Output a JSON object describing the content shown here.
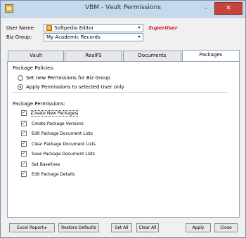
{
  "window": {
    "title": "VBM - Vault Permissions",
    "minimize_glyph": "–",
    "close_glyph": "✕"
  },
  "form": {
    "user_name_label": "User Name:",
    "user_name_value": "Softpedia Editor",
    "role_badge": "SuperUser",
    "biz_group_label": "Biz Group:",
    "biz_group_value": "My Academic Records",
    "dropdown_glyph": "▾",
    "logo_badge_glyph": "s"
  },
  "tabs": [
    {
      "label": "Vault",
      "active": false
    },
    {
      "label": "RealFS",
      "active": false
    },
    {
      "label": "Documents",
      "active": false
    },
    {
      "label": "Packages",
      "active": true
    }
  ],
  "packages": {
    "policies_label": "Package Policies:",
    "option_biz_group": "Set new Permissions for Biz Group",
    "option_selected_user": "Apply Permissions to selected User only",
    "selected_option": "option_selected_user",
    "permissions_label": "Package Permissions:",
    "permissions": [
      {
        "label": "Create New Packages",
        "checked": true
      },
      {
        "label": "Create Package Versions",
        "checked": true
      },
      {
        "label": "Edit Package Document Lists",
        "checked": true
      },
      {
        "label": "Clear Package Document Lists",
        "checked": true
      },
      {
        "label": "Save Package Document Lists",
        "checked": true
      },
      {
        "label": "Set Baselines",
        "checked": true
      },
      {
        "label": "Edit Package Details",
        "checked": true
      }
    ],
    "check_glyph": "✓"
  },
  "buttons": {
    "excel_report": "Excel Report",
    "excel_arrow": "▸",
    "restore_defaults": "Restore Defaults",
    "set_all": "Set All",
    "clear_all": "Clear All",
    "apply": "Apply",
    "close": "Close"
  },
  "colors": {
    "role_badge": "#d3202f",
    "titlebar": "#c6d8ec",
    "close_button": "#c7443a"
  }
}
